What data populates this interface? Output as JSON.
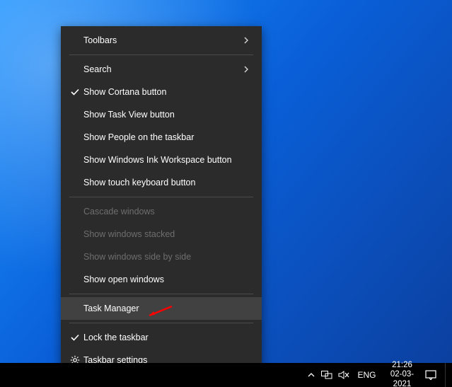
{
  "menu": {
    "items": [
      {
        "label": "Toolbars",
        "icon": null,
        "submenu": true,
        "disabled": false,
        "highlight": false
      },
      {
        "sep": true
      },
      {
        "label": "Search",
        "icon": null,
        "submenu": true,
        "disabled": false,
        "highlight": false
      },
      {
        "label": "Show Cortana button",
        "icon": "check",
        "submenu": false,
        "disabled": false,
        "highlight": false
      },
      {
        "label": "Show Task View button",
        "icon": null,
        "submenu": false,
        "disabled": false,
        "highlight": false
      },
      {
        "label": "Show People on the taskbar",
        "icon": null,
        "submenu": false,
        "disabled": false,
        "highlight": false
      },
      {
        "label": "Show Windows Ink Workspace button",
        "icon": null,
        "submenu": false,
        "disabled": false,
        "highlight": false
      },
      {
        "label": "Show touch keyboard button",
        "icon": null,
        "submenu": false,
        "disabled": false,
        "highlight": false
      },
      {
        "sep": true
      },
      {
        "label": "Cascade windows",
        "icon": null,
        "submenu": false,
        "disabled": true,
        "highlight": false
      },
      {
        "label": "Show windows stacked",
        "icon": null,
        "submenu": false,
        "disabled": true,
        "highlight": false
      },
      {
        "label": "Show windows side by side",
        "icon": null,
        "submenu": false,
        "disabled": true,
        "highlight": false
      },
      {
        "label": "Show open windows",
        "icon": null,
        "submenu": false,
        "disabled": false,
        "highlight": false
      },
      {
        "sep": true
      },
      {
        "label": "Task Manager",
        "icon": null,
        "submenu": false,
        "disabled": false,
        "highlight": true
      },
      {
        "sep": true
      },
      {
        "label": "Lock the taskbar",
        "icon": "check",
        "submenu": false,
        "disabled": false,
        "highlight": false
      },
      {
        "label": "Taskbar settings",
        "icon": "gear",
        "submenu": false,
        "disabled": false,
        "highlight": false
      }
    ]
  },
  "taskbar": {
    "language": "ENG",
    "time": "21:26",
    "date": "02-03-2021"
  }
}
